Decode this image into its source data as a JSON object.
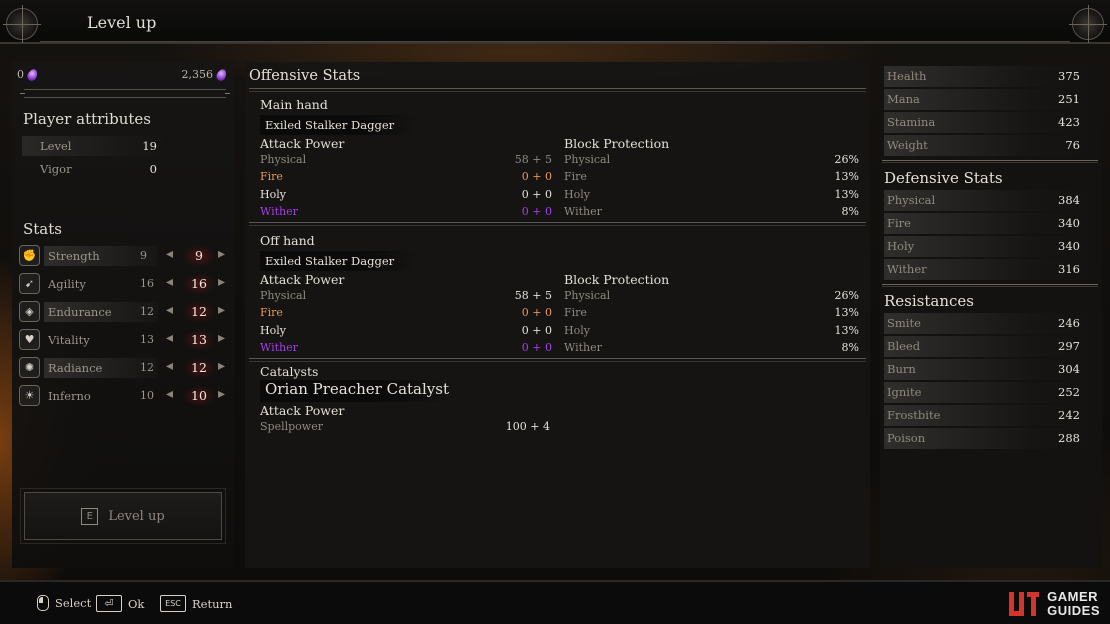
{
  "header": {
    "title": "Level up"
  },
  "left": {
    "souls_current": "0",
    "souls_next": "2,356",
    "xp_progress_percent": 0,
    "player_attributes": {
      "heading": "Player attributes",
      "rows": [
        {
          "label": "Level",
          "value": "19"
        },
        {
          "label": "Vigor",
          "value": "0"
        }
      ]
    },
    "stats": {
      "heading": "Stats",
      "rows": [
        {
          "icon": "strength-icon",
          "label": "Strength",
          "base": "9",
          "current": "9"
        },
        {
          "icon": "agility-icon",
          "label": "Agility",
          "base": "16",
          "current": "16"
        },
        {
          "icon": "endurance-icon",
          "label": "Endurance",
          "base": "12",
          "current": "12"
        },
        {
          "icon": "vitality-icon",
          "label": "Vitality",
          "base": "13",
          "current": "13"
        },
        {
          "icon": "radiance-icon",
          "label": "Radiance",
          "base": "12",
          "current": "12"
        },
        {
          "icon": "inferno-icon",
          "label": "Inferno",
          "base": "10",
          "current": "10"
        }
      ]
    },
    "level_up_button": {
      "key": "E",
      "label": "Level up"
    }
  },
  "offensive": {
    "heading": "Offensive Stats",
    "main_hand": {
      "heading": "Main hand",
      "weapon": "Exiled Stalker Dagger",
      "attack_heading": "Attack Power",
      "attack": [
        {
          "label": "Physical",
          "value": "58 + 5"
        },
        {
          "label": "Fire",
          "value": "0 + 0"
        },
        {
          "label": "Holy",
          "value": "0 + 0"
        },
        {
          "label": "Wither",
          "value": "0 + 0"
        }
      ],
      "block_heading": "Block Protection",
      "block": [
        {
          "label": "Physical",
          "value": "26%"
        },
        {
          "label": "Fire",
          "value": "13%"
        },
        {
          "label": "Holy",
          "value": "13%"
        },
        {
          "label": "Wither",
          "value": "8%"
        }
      ]
    },
    "off_hand": {
      "heading": "Off hand",
      "weapon": "Exiled Stalker Dagger",
      "attack_heading": "Attack Power",
      "attack": [
        {
          "label": "Physical",
          "value": "58 + 5"
        },
        {
          "label": "Fire",
          "value": "0 + 0"
        },
        {
          "label": "Holy",
          "value": "0 + 0"
        },
        {
          "label": "Wither",
          "value": "0 + 0"
        }
      ],
      "block_heading": "Block Protection",
      "block": [
        {
          "label": "Physical",
          "value": "26%"
        },
        {
          "label": "Fire",
          "value": "13%"
        },
        {
          "label": "Holy",
          "value": "13%"
        },
        {
          "label": "Wither",
          "value": "8%"
        }
      ]
    },
    "catalysts": {
      "heading": "Catalysts",
      "item": "Orian Preacher Catalyst",
      "attack_heading": "Attack Power",
      "spellpower_label": "Spellpower",
      "spellpower_value": "100 + 4"
    }
  },
  "right": {
    "vitals": [
      {
        "label": "Health",
        "value": "375"
      },
      {
        "label": "Mana",
        "value": "251"
      },
      {
        "label": "Stamina",
        "value": "423"
      },
      {
        "label": "Weight",
        "value": "76"
      }
    ],
    "defensive": {
      "heading": "Defensive Stats",
      "rows": [
        {
          "label": "Physical",
          "value": "384"
        },
        {
          "label": "Fire",
          "value": "340"
        },
        {
          "label": "Holy",
          "value": "340"
        },
        {
          "label": "Wither",
          "value": "316"
        }
      ]
    },
    "resistances": {
      "heading": "Resistances",
      "rows": [
        {
          "label": "Smite",
          "value": "246"
        },
        {
          "label": "Bleed",
          "value": "297"
        },
        {
          "label": "Burn",
          "value": "304"
        },
        {
          "label": "Ignite",
          "value": "252"
        },
        {
          "label": "Frostbite",
          "value": "242"
        },
        {
          "label": "Poison",
          "value": "288"
        }
      ]
    }
  },
  "footer": {
    "hints": [
      {
        "icon": "mouse-icon",
        "label": "Select"
      },
      {
        "icon": "enter-key-icon",
        "label": "Ok"
      },
      {
        "icon": "esc-key-icon",
        "key": "ESC",
        "label": "Return"
      }
    ],
    "brand_line1": "GAMER",
    "brand_line2": "GUIDES",
    "brand_color": "#d3352c"
  },
  "colors": {
    "fire": "#e89553",
    "wither": "#a43ee6",
    "soul": "#a24ee0"
  }
}
